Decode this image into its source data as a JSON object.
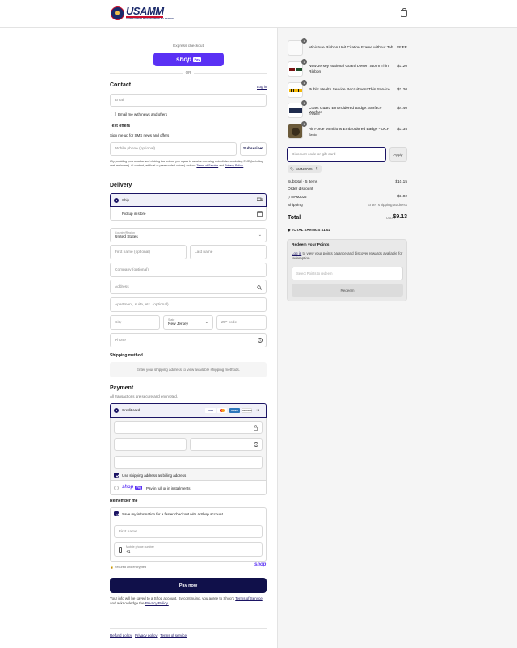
{
  "header": {
    "logo_word": "USAMM",
    "logo_sub": "UNITED STATES MILITARY MEDALS & BADGES"
  },
  "express": {
    "title": "Express checkout",
    "shop_label": "shop",
    "shop_pay": "Pay",
    "or": "OR"
  },
  "contact": {
    "title": "Contact",
    "login": "Log in",
    "email_placeholder": "Email",
    "news_label": "Email me with news and offers"
  },
  "sms": {
    "title": "Text offers",
    "signup": "Sign me up for SMS news and offers",
    "phone_placeholder": "Mobile phone (optional)",
    "subscribe": "Subscribe*",
    "disclaimer": "*By providing your number and clicking the button, you agree to receive recurring auto-dialed marketing SMS (including cart reminders). AI content, artificial or prerecorded voices) and our",
    "tos": "Terms of Service",
    "and": "and",
    "privacy": "Privacy Policy."
  },
  "delivery": {
    "title": "Delivery",
    "ship": "Ship",
    "pickup": "Pickup in store",
    "country_label": "Country/Region",
    "country_value": "United States",
    "first_name": "First name (optional)",
    "last_name": "Last name",
    "company": "Company (optional)",
    "address": "Address",
    "apartment": "Apartment, suite, etc. (optional)",
    "city": "City",
    "state_label": "State",
    "state_value": "New Jersey",
    "zip": "ZIP code",
    "phone": "Phone"
  },
  "shipping_method": {
    "title": "Shipping method",
    "note": "Enter your shipping address to view available shipping methods."
  },
  "payment": {
    "title": "Payment",
    "subtitle": "All transactions are secure and encrypted.",
    "credit_card": "Credit card",
    "cards": [
      "VISA",
      "MC",
      "AMEX",
      "DISCOVER",
      "+5"
    ],
    "billing_label": "Use shipping address as billing address",
    "shop_pay_note": "Pay in full or in installments",
    "shop_label": "shop",
    "shop_pay": "Pay"
  },
  "remember": {
    "title": "Remember me",
    "save_label": "Save my information for a faster checkout with a Shop account",
    "first_name": "First name",
    "mobile_label": "Mobile phone number",
    "mobile_value": "+1",
    "secure": "Secured and encrypted",
    "shop_brand": "shop"
  },
  "pay_now": "Pay now",
  "legal": {
    "text": "Your info will be saved to a Shop account. By continuing, you agree to Shop's",
    "tos": "Terms of Service",
    "and": "and acknowledge the",
    "privacy": "Privacy Policy."
  },
  "footer": {
    "links": [
      "Refund policy",
      "Privacy policy",
      "Terms of service"
    ]
  },
  "cart": {
    "items": [
      {
        "qty": "1",
        "name": "Miniature Ribbon Unit Citation Frame without Tab",
        "variant": "",
        "price": "FREE"
      },
      {
        "qty": "1",
        "name": "New Jersey National Guard Desert Storm Thin Ribbon",
        "variant": "",
        "price": "$1.20"
      },
      {
        "qty": "1",
        "name": "Public Health Service Recruitment Thin Service",
        "variant": "",
        "price": "$1.20"
      },
      {
        "qty": "1",
        "name": "Coast Guard Embroidered Badge: Surface Warfare",
        "variant": "Enlisted",
        "price": "$4.40"
      },
      {
        "qty": "1",
        "name": "Air Force Munitions Embroidered Badge - OCP",
        "variant": "Senior",
        "price": "$3.35"
      }
    ],
    "discount_placeholder": "Discount code or gift card",
    "apply": "Apply",
    "code": "MAM2025",
    "subtotal_label": "Subtotal · 5 items",
    "subtotal": "$10.15",
    "order_discount": "Order discount",
    "discount_code": "MAM2025",
    "discount_value": "- $1.02",
    "shipping_label": "Shipping",
    "shipping_value": "Enter shipping address",
    "total_label": "Total",
    "currency": "USD",
    "total": "$9.13",
    "savings_label": "TOTAL SAVINGS",
    "savings_value": "$1.02"
  },
  "points": {
    "title": "Redeem your Points",
    "login": "Log in",
    "text": "to view your points balance and discover rewards available for redemption.",
    "select": "Select Points to redeem",
    "redeem": "Redeem"
  }
}
